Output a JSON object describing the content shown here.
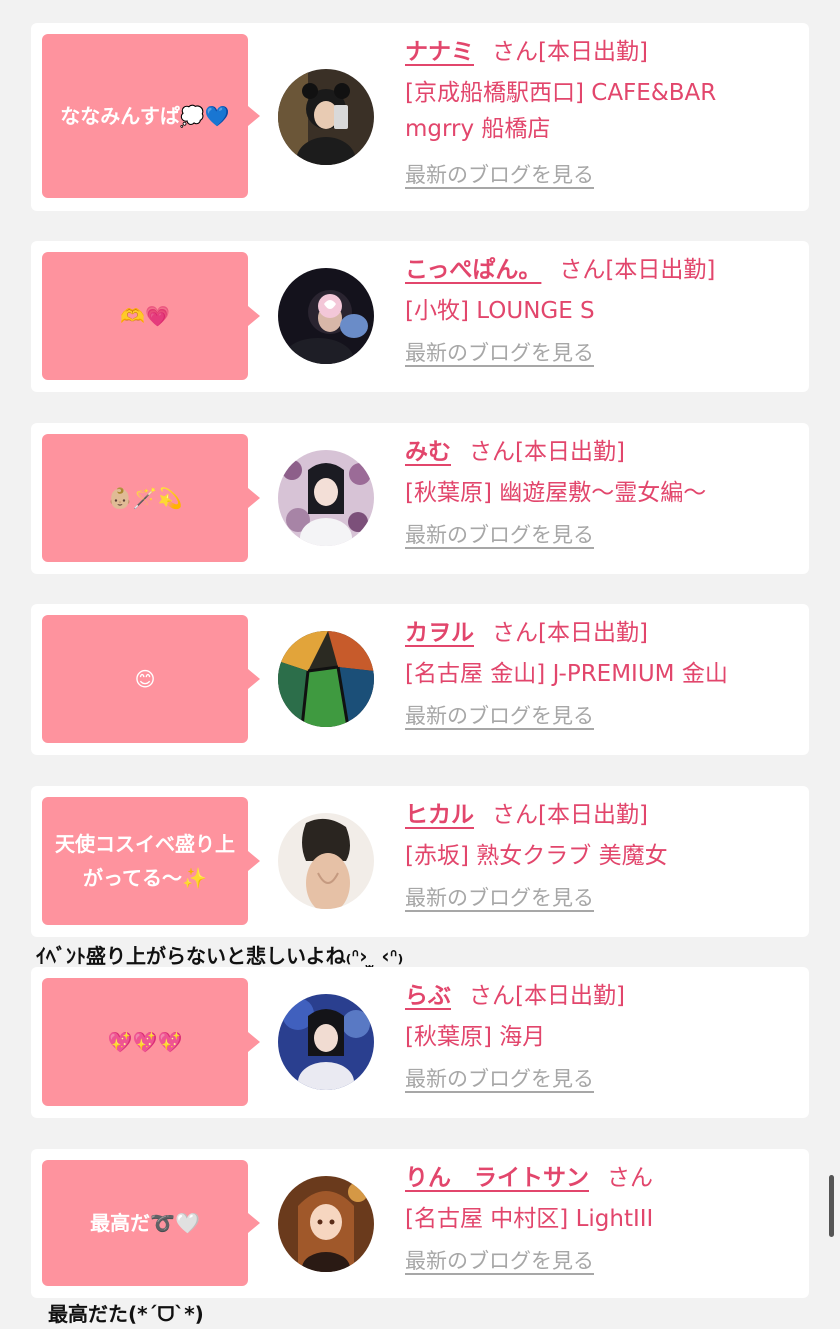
{
  "colors": {
    "accent": "#e2466c",
    "bubble": "#fe939e",
    "link_gray": "#a7a7a7",
    "background": "#f2f2f2"
  },
  "blog_link_label": "最新のブログを見る",
  "cards": [
    {
      "bubble_text": "ななみんすぱ💭💙",
      "name": "ナナミ",
      "status": "さん[本日出勤]",
      "shop_lines": [
        "[京成船橋駅西口] CAFE&BAR",
        "mgrry 船橋店"
      ],
      "avatar_icon": "girl-selfie-photo"
    },
    {
      "bubble_text": "🫶💗",
      "name": "こっぺぱん。",
      "status": "さん[本日出勤]",
      "shop_lines": [
        "[小牧] LOUNGE S"
      ],
      "avatar_icon": "girl-heart-sticker-photo"
    },
    {
      "bubble_text": "👶🏼🪄💫",
      "name": "みむ",
      "status": "さん[本日出勤]",
      "shop_lines": [
        "[秋葉原] 幽遊屋敷〜霊女編〜"
      ],
      "avatar_icon": "girl-flowers-photo"
    },
    {
      "bubble_text": "😊",
      "name": "カヲル",
      "status": "さん[本日出勤]",
      "shop_lines": [
        "[名古屋 金山] J-PREMIUM 金山"
      ],
      "avatar_icon": "stained-glass-photo"
    },
    {
      "bubble_text": "天使コスイベ盛り上がってる〜✨",
      "name": "ヒカル",
      "status": "さん[本日出勤]",
      "shop_lines": [
        "[赤坂] 熟女クラブ 美魔女"
      ],
      "avatar_icon": "woman-back-photo",
      "comment_below": "ｲﾍﾞﾝﾄ盛り上がらないと悲しいよね₍ᐢ›‎ ̫ ‹ᐢ₎"
    },
    {
      "bubble_text": "💖💖💖",
      "name": "らぶ",
      "status": "さん[本日出勤]",
      "shop_lines": [
        "[秋葉原] 海月"
      ],
      "avatar_icon": "girl-aquarium-photo"
    },
    {
      "bubble_text": "最高だ➰🤍",
      "name": "りん　ライトサン",
      "status": "さん",
      "shop_lines": [
        "[名古屋 中村区] LightIII"
      ],
      "avatar_icon": "anime-girl-illustration",
      "comment_below": "最高だた(*´ᗜ`*)"
    }
  ]
}
